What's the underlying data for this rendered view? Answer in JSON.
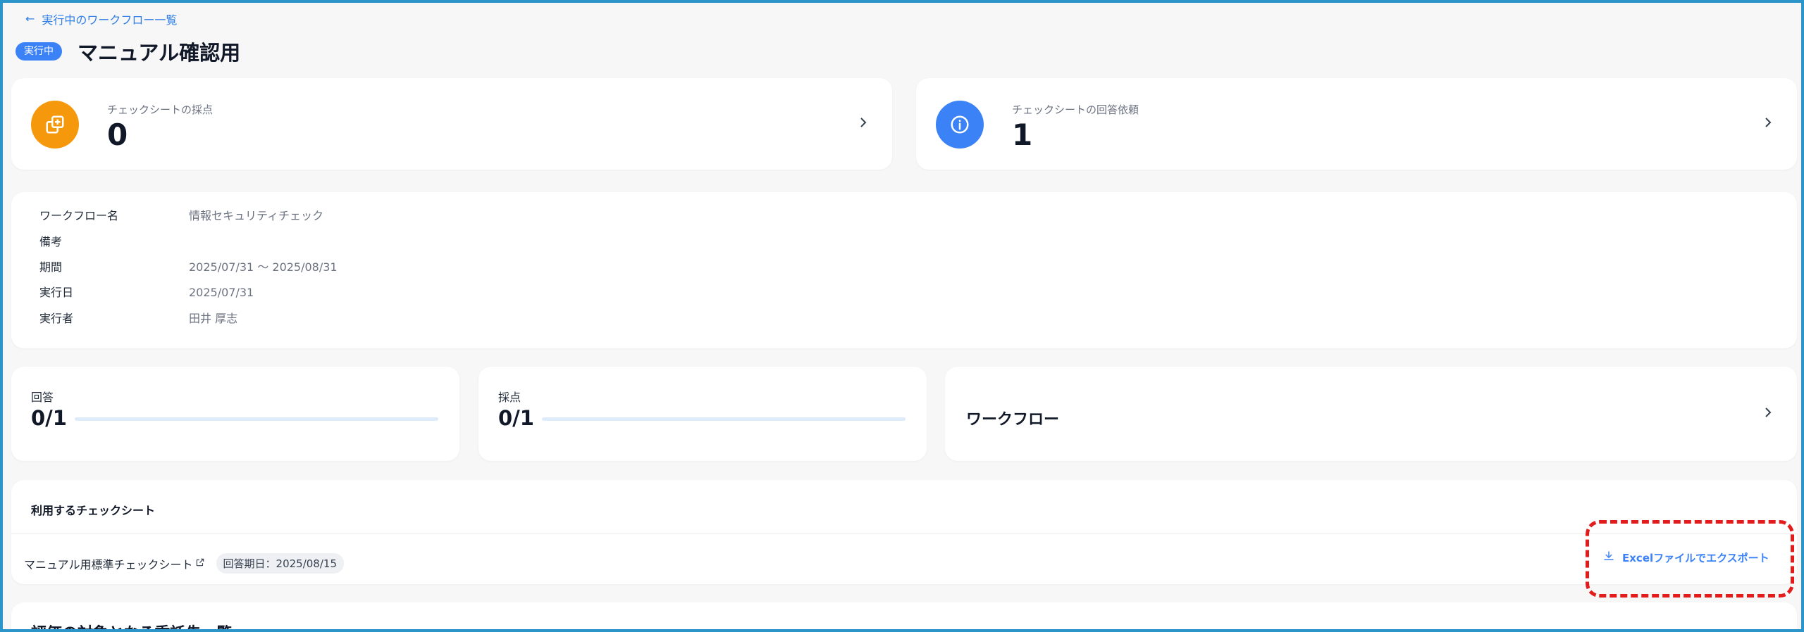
{
  "back_link": {
    "label": "実行中のワークフロー一覧"
  },
  "header": {
    "status": "実行中",
    "title": "マニュアル確認用"
  },
  "stats": [
    {
      "label": "チェックシートの採点",
      "value": "0",
      "icon": "copy-icon",
      "color": "#f5980b"
    },
    {
      "label": "チェックシートの回答依頼",
      "value": "1",
      "icon": "info-icon",
      "color": "#3b82f6"
    }
  ],
  "info": {
    "rows": [
      {
        "key": "ワークフロー名",
        "value": "情報セキュリティチェック"
      },
      {
        "key": "備考",
        "value": ""
      },
      {
        "key": "期間",
        "value": "2025/07/31 〜 2025/08/31"
      },
      {
        "key": "実行日",
        "value": "2025/07/31"
      },
      {
        "key": "実行者",
        "value": "田井 厚志"
      }
    ]
  },
  "progress": [
    {
      "label": "回答",
      "value": "0/1",
      "fraction": 0
    },
    {
      "label": "採点",
      "value": "0/1",
      "fraction": 0
    }
  ],
  "workflow_card": {
    "label": "ワークフロー"
  },
  "sheets": {
    "heading": "利用するチェックシート",
    "items": [
      {
        "name": "マニュアル用標準チェックシート",
        "due": "回答期日：2025/08/15"
      }
    ],
    "export_label": "Excelファイルでエクスポート"
  },
  "next_section": {
    "title": "評価の対象となる委託先一覧"
  },
  "colors": {
    "accent": "#3b82f6",
    "highlight": "#e31b1b",
    "background": "#f7f7f8"
  }
}
